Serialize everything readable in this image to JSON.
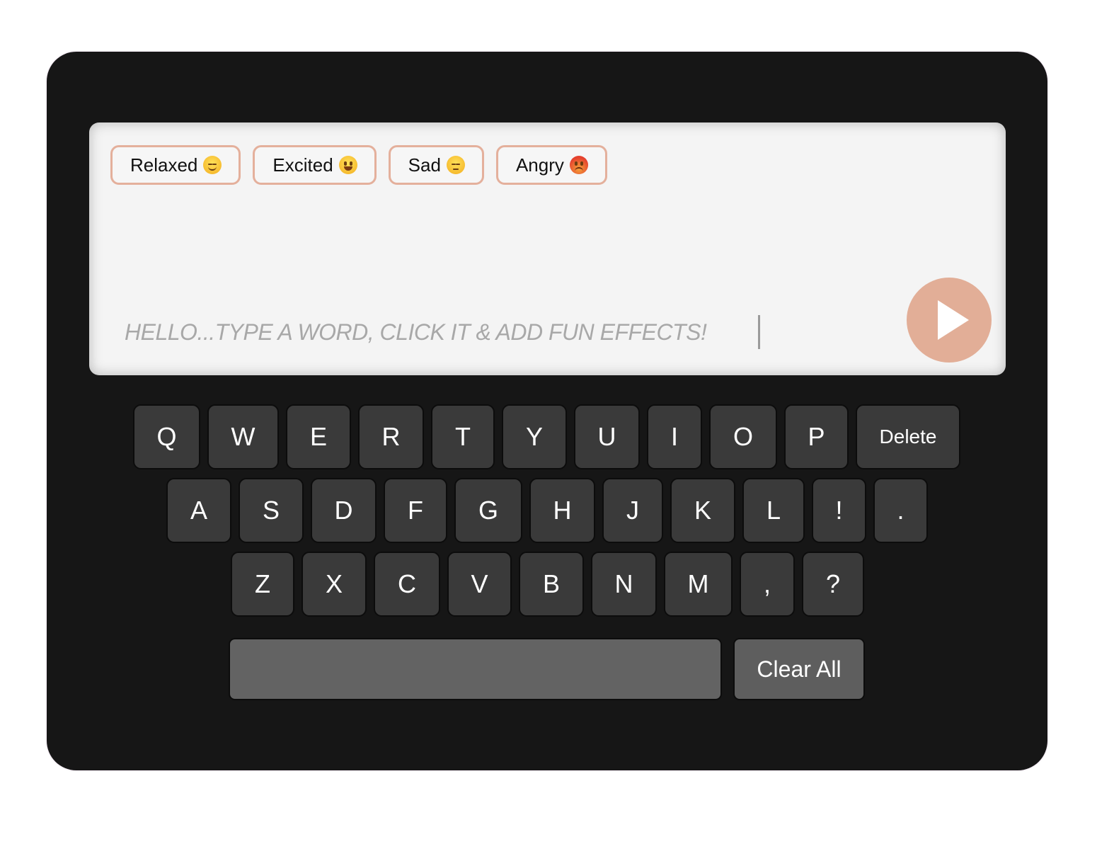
{
  "mood_buttons": [
    {
      "label": "Relaxed",
      "emoji": "relaxed-face-icon"
    },
    {
      "label": "Excited",
      "emoji": "grinning-face-icon"
    },
    {
      "label": "Sad",
      "emoji": "pensive-face-icon"
    },
    {
      "label": "Angry",
      "emoji": "angry-face-icon"
    }
  ],
  "input": {
    "placeholder": "HELLO...TYPE A WORD, CLICK IT & ADD FUN EFFECTS!"
  },
  "play_button": {
    "icon": "play-icon"
  },
  "keyboard": {
    "row1": [
      "Q",
      "W",
      "E",
      "R",
      "T",
      "Y",
      "U",
      "I",
      "O",
      "P",
      "Delete"
    ],
    "row2": [
      "A",
      "S",
      "D",
      "F",
      "G",
      "H",
      "J",
      "K",
      "L",
      "!",
      "."
    ],
    "row3": [
      "Z",
      "X",
      "C",
      "V",
      "B",
      "N",
      "M",
      ",",
      "?"
    ],
    "clear_label": "Clear All"
  },
  "colors": {
    "device": "#161616",
    "screen": "#f4f4f4",
    "accent": "#e2ae97",
    "key": "#3a3a3a",
    "space": "#636363"
  }
}
